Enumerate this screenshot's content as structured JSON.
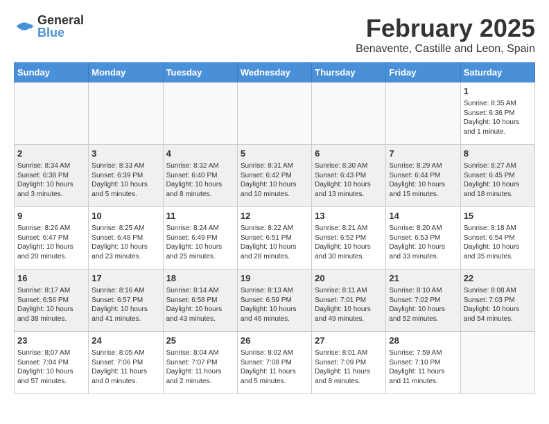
{
  "logo": {
    "general": "General",
    "blue": "Blue"
  },
  "title": {
    "month": "February 2025",
    "location": "Benavente, Castille and Leon, Spain"
  },
  "headers": [
    "Sunday",
    "Monday",
    "Tuesday",
    "Wednesday",
    "Thursday",
    "Friday",
    "Saturday"
  ],
  "weeks": [
    {
      "shaded": false,
      "days": [
        {
          "number": "",
          "info": ""
        },
        {
          "number": "",
          "info": ""
        },
        {
          "number": "",
          "info": ""
        },
        {
          "number": "",
          "info": ""
        },
        {
          "number": "",
          "info": ""
        },
        {
          "number": "",
          "info": ""
        },
        {
          "number": "1",
          "info": "Sunrise: 8:35 AM\nSunset: 6:36 PM\nDaylight: 10 hours\nand 1 minute."
        }
      ]
    },
    {
      "shaded": true,
      "days": [
        {
          "number": "2",
          "info": "Sunrise: 8:34 AM\nSunset: 6:38 PM\nDaylight: 10 hours\nand 3 minutes."
        },
        {
          "number": "3",
          "info": "Sunrise: 8:33 AM\nSunset: 6:39 PM\nDaylight: 10 hours\nand 5 minutes."
        },
        {
          "number": "4",
          "info": "Sunrise: 8:32 AM\nSunset: 6:40 PM\nDaylight: 10 hours\nand 8 minutes."
        },
        {
          "number": "5",
          "info": "Sunrise: 8:31 AM\nSunset: 6:42 PM\nDaylight: 10 hours\nand 10 minutes."
        },
        {
          "number": "6",
          "info": "Sunrise: 8:30 AM\nSunset: 6:43 PM\nDaylight: 10 hours\nand 13 minutes."
        },
        {
          "number": "7",
          "info": "Sunrise: 8:29 AM\nSunset: 6:44 PM\nDaylight: 10 hours\nand 15 minutes."
        },
        {
          "number": "8",
          "info": "Sunrise: 8:27 AM\nSunset: 6:45 PM\nDaylight: 10 hours\nand 18 minutes."
        }
      ]
    },
    {
      "shaded": false,
      "days": [
        {
          "number": "9",
          "info": "Sunrise: 8:26 AM\nSunset: 6:47 PM\nDaylight: 10 hours\nand 20 minutes."
        },
        {
          "number": "10",
          "info": "Sunrise: 8:25 AM\nSunset: 6:48 PM\nDaylight: 10 hours\nand 23 minutes."
        },
        {
          "number": "11",
          "info": "Sunrise: 8:24 AM\nSunset: 6:49 PM\nDaylight: 10 hours\nand 25 minutes."
        },
        {
          "number": "12",
          "info": "Sunrise: 8:22 AM\nSunset: 6:51 PM\nDaylight: 10 hours\nand 28 minutes."
        },
        {
          "number": "13",
          "info": "Sunrise: 8:21 AM\nSunset: 6:52 PM\nDaylight: 10 hours\nand 30 minutes."
        },
        {
          "number": "14",
          "info": "Sunrise: 8:20 AM\nSunset: 6:53 PM\nDaylight: 10 hours\nand 33 minutes."
        },
        {
          "number": "15",
          "info": "Sunrise: 8:18 AM\nSunset: 6:54 PM\nDaylight: 10 hours\nand 35 minutes."
        }
      ]
    },
    {
      "shaded": true,
      "days": [
        {
          "number": "16",
          "info": "Sunrise: 8:17 AM\nSunset: 6:56 PM\nDaylight: 10 hours\nand 38 minutes."
        },
        {
          "number": "17",
          "info": "Sunrise: 8:16 AM\nSunset: 6:57 PM\nDaylight: 10 hours\nand 41 minutes."
        },
        {
          "number": "18",
          "info": "Sunrise: 8:14 AM\nSunset: 6:58 PM\nDaylight: 10 hours\nand 43 minutes."
        },
        {
          "number": "19",
          "info": "Sunrise: 8:13 AM\nSunset: 6:59 PM\nDaylight: 10 hours\nand 46 minutes."
        },
        {
          "number": "20",
          "info": "Sunrise: 8:11 AM\nSunset: 7:01 PM\nDaylight: 10 hours\nand 49 minutes."
        },
        {
          "number": "21",
          "info": "Sunrise: 8:10 AM\nSunset: 7:02 PM\nDaylight: 10 hours\nand 52 minutes."
        },
        {
          "number": "22",
          "info": "Sunrise: 8:08 AM\nSunset: 7:03 PM\nDaylight: 10 hours\nand 54 minutes."
        }
      ]
    },
    {
      "shaded": false,
      "days": [
        {
          "number": "23",
          "info": "Sunrise: 8:07 AM\nSunset: 7:04 PM\nDaylight: 10 hours\nand 57 minutes."
        },
        {
          "number": "24",
          "info": "Sunrise: 8:05 AM\nSunset: 7:06 PM\nDaylight: 11 hours\nand 0 minutes."
        },
        {
          "number": "25",
          "info": "Sunrise: 8:04 AM\nSunset: 7:07 PM\nDaylight: 11 hours\nand 2 minutes."
        },
        {
          "number": "26",
          "info": "Sunrise: 8:02 AM\nSunset: 7:08 PM\nDaylight: 11 hours\nand 5 minutes."
        },
        {
          "number": "27",
          "info": "Sunrise: 8:01 AM\nSunset: 7:09 PM\nDaylight: 11 hours\nand 8 minutes."
        },
        {
          "number": "28",
          "info": "Sunrise: 7:59 AM\nSunset: 7:10 PM\nDaylight: 11 hours\nand 11 minutes."
        },
        {
          "number": "",
          "info": ""
        }
      ]
    }
  ]
}
